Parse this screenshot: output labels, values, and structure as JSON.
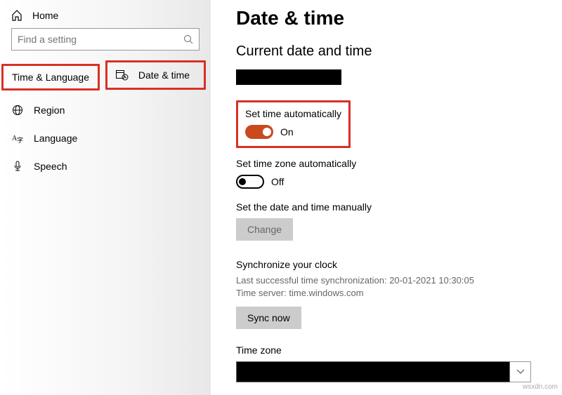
{
  "sidebar": {
    "home_label": "Home",
    "search_placeholder": "Find a setting",
    "section_title": "Time & Language",
    "items": [
      {
        "label": "Date & time"
      },
      {
        "label": "Region"
      },
      {
        "label": "Language"
      },
      {
        "label": "Speech"
      }
    ]
  },
  "main": {
    "title": "Date & time",
    "subtitle": "Current date and time",
    "set_time_auto": {
      "label": "Set time automatically",
      "value": "On"
    },
    "set_zone_auto": {
      "label": "Set time zone automatically",
      "value": "Off"
    },
    "manual": {
      "label": "Set the date and time manually",
      "button": "Change"
    },
    "sync": {
      "title": "Synchronize your clock",
      "last_line": "Last successful time synchronization: 20-01-2021 10:30:05",
      "server_line": "Time server: time.windows.com",
      "button": "Sync now"
    },
    "timezone": {
      "label": "Time zone"
    }
  },
  "watermark": "wsxdn.com"
}
